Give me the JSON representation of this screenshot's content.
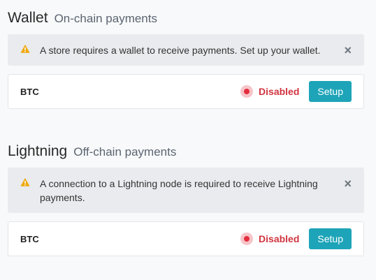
{
  "wallet": {
    "title": "Wallet",
    "subtitle": "On-chain payments",
    "alert": {
      "icon": "warning-triangle-icon",
      "text": "A store requires a wallet to receive payments. Set up your wallet.",
      "close": "×"
    },
    "row": {
      "asset": "BTC",
      "status": "Disabled",
      "button": "Setup"
    }
  },
  "lightning": {
    "title": "Lightning",
    "subtitle": "Off-chain payments",
    "alert": {
      "icon": "warning-triangle-icon",
      "text": "A connection to a Lightning node is required to receive Lightning payments.",
      "close": "×"
    },
    "row": {
      "asset": "BTC",
      "status": "Disabled",
      "button": "Setup"
    }
  },
  "colors": {
    "accent": "#1ea4b8",
    "danger": "#d13440",
    "warning": "#f0a70a"
  }
}
